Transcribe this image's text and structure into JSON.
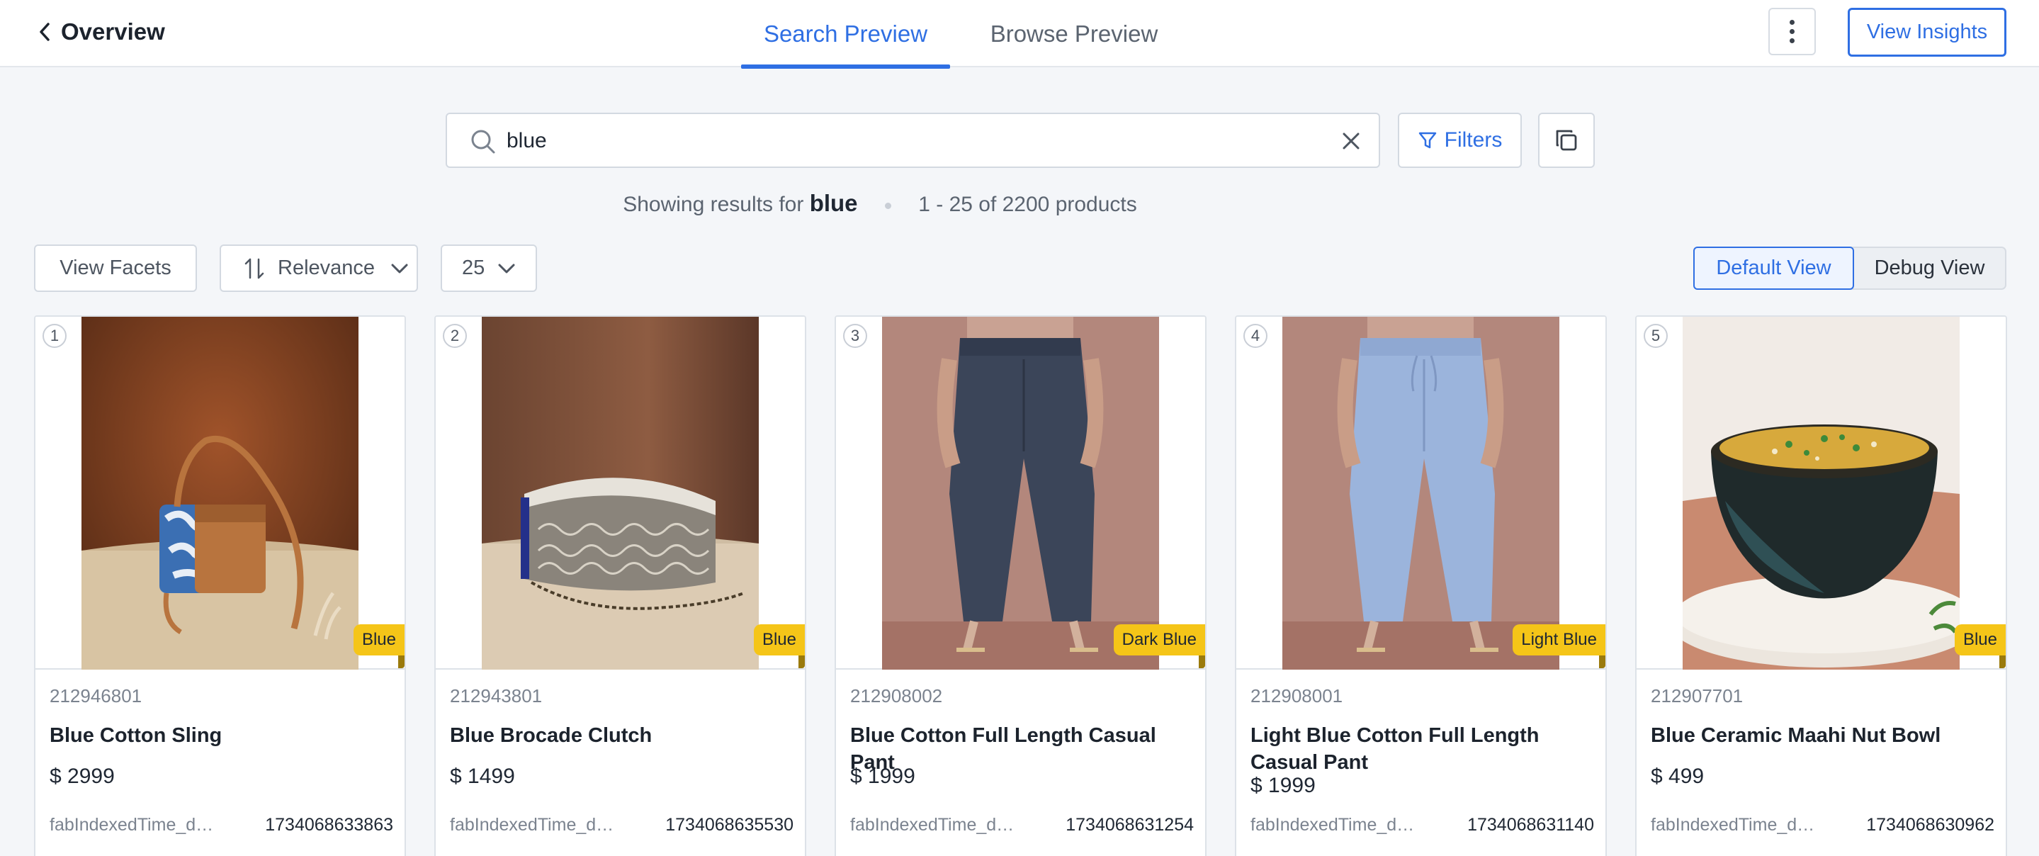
{
  "header": {
    "back_label": "Overview",
    "tabs": [
      {
        "label": "Search Preview",
        "active": true
      },
      {
        "label": "Browse Preview",
        "active": false
      }
    ],
    "insights_label": "View Insights",
    "accent_color": "#2f6fe3"
  },
  "search": {
    "value": "blue",
    "placeholder": "",
    "filters_label": "Filters"
  },
  "summary": {
    "prefix": "Showing results for",
    "query": "blue",
    "range": "1 - 25 of 2200 products"
  },
  "toolbar": {
    "facets_label": "View Facets",
    "sort_label": "Relevance",
    "per_page": "25",
    "views": [
      {
        "label": "Default View",
        "active": true
      },
      {
        "label": "Debug View",
        "active": false
      }
    ]
  },
  "products": [
    {
      "rank": "1",
      "badge": "Blue",
      "id": "212946801",
      "name": "Blue Cotton Sling",
      "price": "$ 2999",
      "meta_key": "fabIndexedTime_da...",
      "meta_value": "1734068633863",
      "image": "sling-bag"
    },
    {
      "rank": "2",
      "badge": "Blue",
      "id": "212943801",
      "name": "Blue Brocade Clutch",
      "price": "$ 1499",
      "meta_key": "fabIndexedTime_da...",
      "meta_value": "1734068635530",
      "image": "clutch"
    },
    {
      "rank": "3",
      "badge": "Dark Blue",
      "id": "212908002",
      "name": "Blue Cotton Full Length Casual Pant",
      "price": "$ 1999",
      "meta_key": "fabIndexedTime_da...",
      "meta_value": "1734068631254",
      "image": "dark-pant"
    },
    {
      "rank": "4",
      "badge": "Light Blue",
      "id": "212908001",
      "name": "Light Blue Cotton Full Length Casual Pant",
      "price": "$ 1999",
      "meta_key": "fabIndexedTime_da...",
      "meta_value": "1734068631140",
      "image": "light-pant"
    },
    {
      "rank": "5",
      "badge": "Blue",
      "id": "212907701",
      "name": "Blue Ceramic Maahi Nut Bowl",
      "price": "$ 499",
      "meta_key": "fabIndexedTime_da...",
      "meta_value": "1734068630962",
      "image": "bowl"
    }
  ]
}
